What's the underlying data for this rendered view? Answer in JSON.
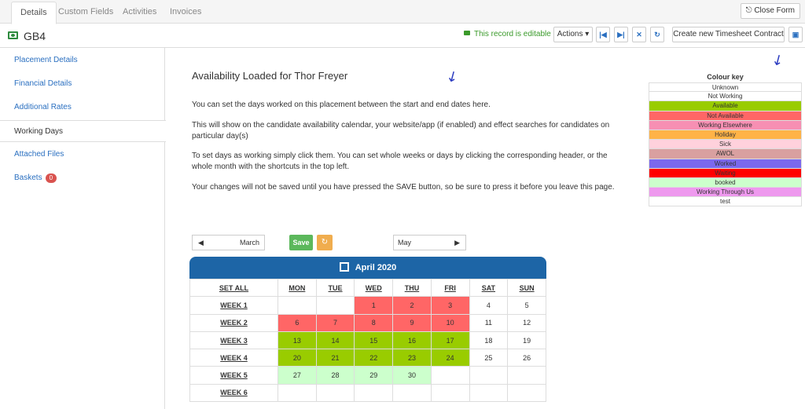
{
  "tabs": [
    {
      "label": "Details"
    },
    {
      "label": "Custom Fields"
    },
    {
      "label": "Activities"
    },
    {
      "label": "Invoices"
    }
  ],
  "close_form": "Close Form",
  "record": {
    "title": "GB4",
    "editable": "This record is editable"
  },
  "toolbar": {
    "actions": "Actions ▾",
    "create": "Create new Timesheet Contract"
  },
  "sidebar": {
    "items": [
      {
        "label": "Placement Details"
      },
      {
        "label": "Financial Details"
      },
      {
        "label": "Additional Rates"
      },
      {
        "label": "Working Days"
      },
      {
        "label": "Attached Files"
      },
      {
        "label": "Baskets",
        "badge": "0"
      }
    ]
  },
  "main": {
    "title": "Availability Loaded for Thor Freyer",
    "p1": "You can set the days worked on this placement between the start and end dates here.",
    "p2": "This will show on the candidate availability calendar, your website/app (if enabled) and effect searches for candidates on particular day(s)",
    "p3": "To set days as working simply click them. You can set whole weeks or days by clicking the corresponding header, or the whole month with the shortcuts in the top left.",
    "p4": "Your changes will not be saved until you have pressed the SAVE button, so be sure to press it before you leave this page."
  },
  "colour_key": {
    "title": "Colour key",
    "items": [
      {
        "label": "Unknown",
        "color": "#ffffff"
      },
      {
        "label": "Not Working",
        "color": "#ffffff"
      },
      {
        "label": "Available",
        "color": "#99cc00"
      },
      {
        "label": "Not Available",
        "color": "#ff6666"
      },
      {
        "label": "Working Elsewhere",
        "color": "#f78fb3"
      },
      {
        "label": "Holiday",
        "color": "#ffb347"
      },
      {
        "label": "Sick",
        "color": "#ffd1dc"
      },
      {
        "label": "AWOL",
        "color": "#d9a0a0"
      },
      {
        "label": "Worked",
        "color": "#7b68ee"
      },
      {
        "label": "Waiting",
        "color": "#ff0000"
      },
      {
        "label": "booked",
        "color": "#ccffcc"
      },
      {
        "label": "Working Through Us",
        "color": "#ee99ee"
      },
      {
        "label": "test",
        "color": "#ffffff"
      }
    ]
  },
  "nav": {
    "prev": "March",
    "next": "May",
    "save": "Save"
  },
  "calendar": {
    "month": "April 2020",
    "set_all": "SET ALL",
    "days": [
      "MON",
      "TUE",
      "WED",
      "THU",
      "FRI",
      "SAT",
      "SUN"
    ],
    "weeks": [
      {
        "label": "WEEK 1",
        "cells": [
          {
            "d": "",
            "s": ""
          },
          {
            "d": "",
            "s": ""
          },
          {
            "d": "1",
            "s": "na"
          },
          {
            "d": "2",
            "s": "na"
          },
          {
            "d": "3",
            "s": "na"
          },
          {
            "d": "4",
            "s": ""
          },
          {
            "d": "5",
            "s": ""
          }
        ]
      },
      {
        "label": "WEEK 2",
        "cells": [
          {
            "d": "6",
            "s": "na"
          },
          {
            "d": "7",
            "s": "na"
          },
          {
            "d": "8",
            "s": "na"
          },
          {
            "d": "9",
            "s": "na"
          },
          {
            "d": "10",
            "s": "na"
          },
          {
            "d": "11",
            "s": ""
          },
          {
            "d": "12",
            "s": ""
          }
        ]
      },
      {
        "label": "WEEK 3",
        "cells": [
          {
            "d": "13",
            "s": "av"
          },
          {
            "d": "14",
            "s": "av"
          },
          {
            "d": "15",
            "s": "av"
          },
          {
            "d": "16",
            "s": "av"
          },
          {
            "d": "17",
            "s": "av"
          },
          {
            "d": "18",
            "s": ""
          },
          {
            "d": "19",
            "s": ""
          }
        ]
      },
      {
        "label": "WEEK 4",
        "cells": [
          {
            "d": "20",
            "s": "av"
          },
          {
            "d": "21",
            "s": "av"
          },
          {
            "d": "22",
            "s": "av"
          },
          {
            "d": "23",
            "s": "av"
          },
          {
            "d": "24",
            "s": "av"
          },
          {
            "d": "25",
            "s": ""
          },
          {
            "d": "26",
            "s": ""
          }
        ]
      },
      {
        "label": "WEEK 5",
        "cells": [
          {
            "d": "27",
            "s": "bk"
          },
          {
            "d": "28",
            "s": "bk"
          },
          {
            "d": "29",
            "s": "bk"
          },
          {
            "d": "30",
            "s": "bk"
          },
          {
            "d": "",
            "s": ""
          },
          {
            "d": "",
            "s": ""
          },
          {
            "d": "",
            "s": ""
          }
        ]
      },
      {
        "label": "WEEK 6",
        "cells": [
          {
            "d": "",
            "s": ""
          },
          {
            "d": "",
            "s": ""
          },
          {
            "d": "",
            "s": ""
          },
          {
            "d": "",
            "s": ""
          },
          {
            "d": "",
            "s": ""
          },
          {
            "d": "",
            "s": ""
          },
          {
            "d": "",
            "s": ""
          }
        ]
      }
    ]
  }
}
